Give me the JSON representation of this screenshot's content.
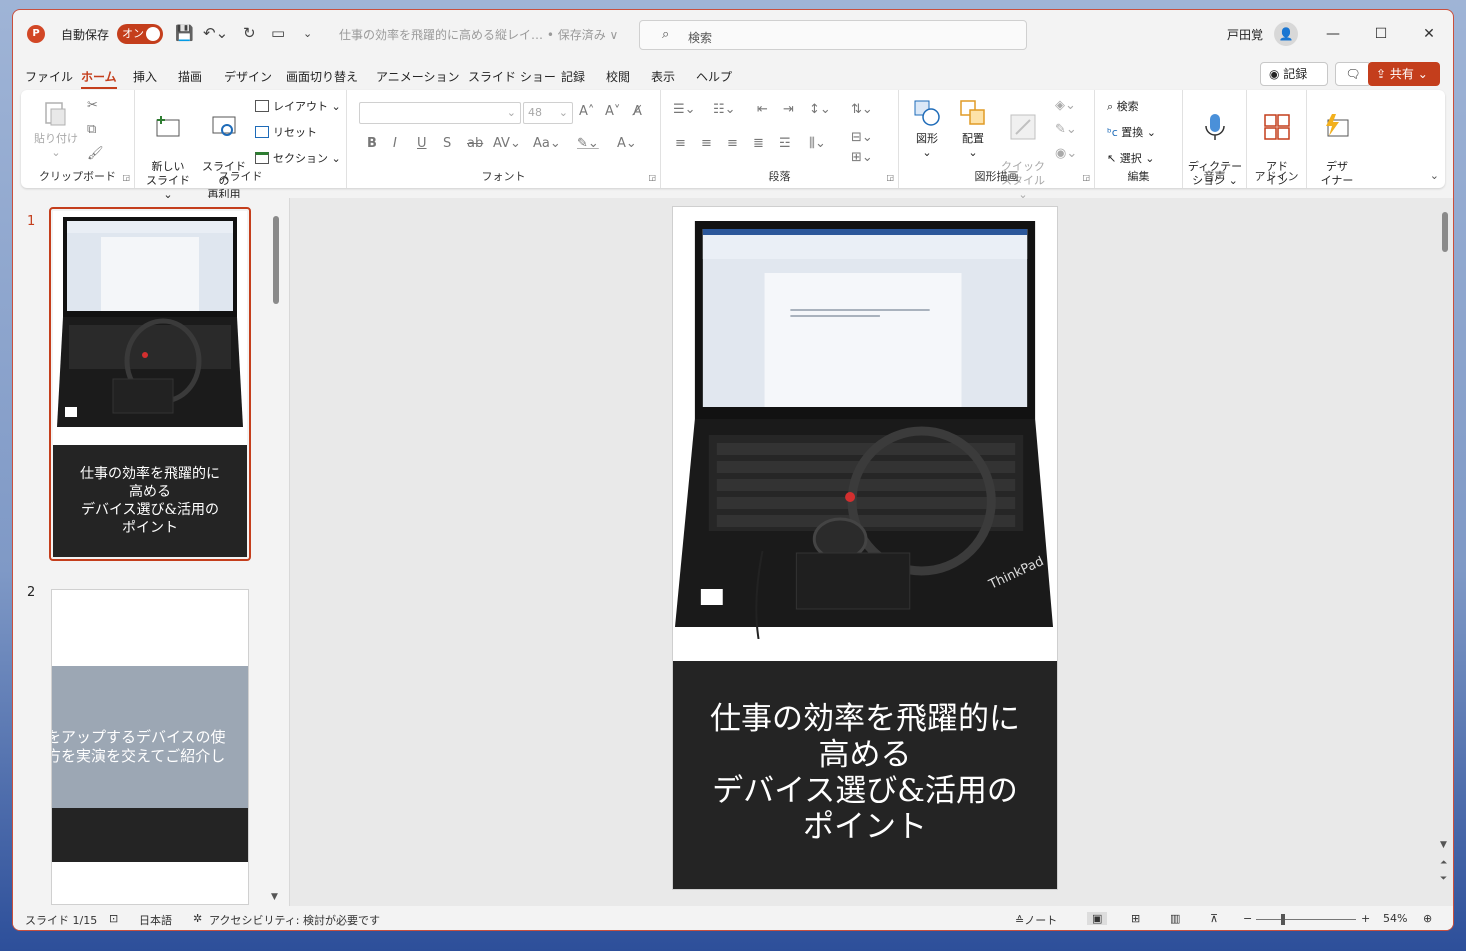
{
  "titlebar": {
    "app_logo": "P",
    "autosave_label": "自動保存",
    "autosave_state": "オン",
    "doc_title": "仕事の効率を飛躍的に高める縦レイ… • 保存済み ∨",
    "search_placeholder": "検索",
    "user_name": "戸田覚"
  },
  "tabs": [
    "ファイル",
    "ホーム",
    "挿入",
    "描画",
    "デザイン",
    "画面切り替え",
    "アニメーション",
    "スライド ショー",
    "記録",
    "校閲",
    "表示",
    "ヘルプ"
  ],
  "actions": {
    "record": "記録",
    "share": "共有"
  },
  "ribbon": {
    "clipboard": {
      "label": "クリップボード",
      "paste": "貼り付け"
    },
    "slides": {
      "label": "スライド",
      "new_slide": "新しい\nスライド ⌄",
      "reuse": "スライドの\n再利用",
      "layout": "レイアウト ⌄",
      "reset": "リセット",
      "section": "セクション ⌄"
    },
    "font": {
      "label": "フォント",
      "font_size": "48"
    },
    "paragraph": {
      "label": "段落"
    },
    "drawing": {
      "label": "図形描画",
      "shapes": "図形",
      "arrange": "配置",
      "quick_styles": "クイック\nスタイル ⌄"
    },
    "editing": {
      "label": "編集",
      "find": "検索",
      "replace": "置換",
      "select": "選択 ⌄"
    },
    "voice": {
      "label": "音声",
      "dictate": "ディクテー\nション ⌄"
    },
    "addins": {
      "label": "アドイン",
      "addins": "アド\nイン"
    },
    "designer": {
      "label": "デザ\nイナー"
    }
  },
  "slides": [
    {
      "number": "1",
      "title": "仕事の効率を飛躍的に\n高める\nデバイス選び&活用の\nポイント"
    },
    {
      "number": "2",
      "text_line1": "をアップするデバイスの使",
      "text_line2": "方を実演を交えてご紹介し"
    }
  ],
  "main_slide": {
    "title": "仕事の効率を飛躍的に\n高める\nデバイス選び&活用の\nポイント"
  },
  "statusbar": {
    "slide_counter": "スライド 1/15",
    "language": "日本語",
    "accessibility": "アクセシビリティ: 検討が必要です",
    "notes": "ノート",
    "zoom": "54%"
  }
}
